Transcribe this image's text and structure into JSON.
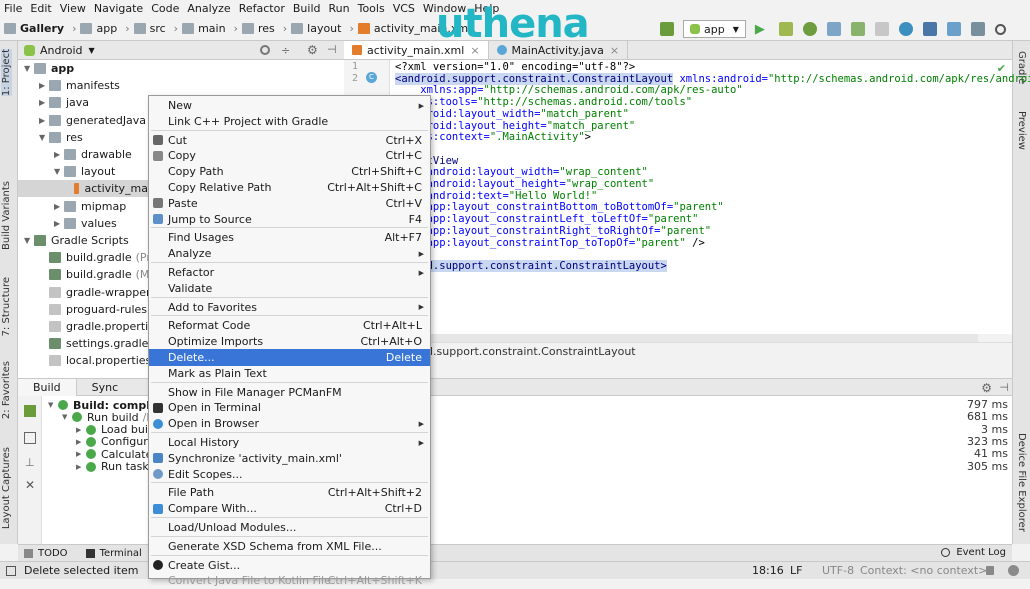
{
  "menubar": [
    "File",
    "Edit",
    "View",
    "Navigate",
    "Code",
    "Analyze",
    "Refactor",
    "Build",
    "Run",
    "Tools",
    "VCS",
    "Window",
    "Help"
  ],
  "breadcrumbs": [
    "Gallery",
    "app",
    "src",
    "main",
    "res",
    "layout",
    "activity_main.xml"
  ],
  "watermark": {
    "text": "uthena",
    "color": "#23b7c6"
  },
  "toolbar": {
    "run_config": "app"
  },
  "left_strip": [
    "1: Project",
    "Build Variants",
    "7: Structure",
    "2: Favorites",
    "Layout Captures"
  ],
  "right_strip": [
    "Gradle",
    "Preview",
    "Device File Explorer"
  ],
  "project": {
    "view": "Android",
    "tree": [
      {
        "label": "app",
        "depth": 0,
        "icon": "folder",
        "expanded": true,
        "bold": true
      },
      {
        "label": "manifests",
        "depth": 1,
        "icon": "folder"
      },
      {
        "label": "java",
        "depth": 1,
        "icon": "folder"
      },
      {
        "label": "generatedJava",
        "depth": 1,
        "icon": "folder"
      },
      {
        "label": "res",
        "depth": 1,
        "icon": "folder",
        "expanded": true
      },
      {
        "label": "drawable",
        "depth": 2,
        "icon": "folder"
      },
      {
        "label": "layout",
        "depth": 2,
        "icon": "folder",
        "expanded": true
      },
      {
        "label": "activity_ma",
        "depth": 3,
        "icon": "xml",
        "selected": true
      },
      {
        "label": "mipmap",
        "depth": 2,
        "icon": "folder"
      },
      {
        "label": "values",
        "depth": 2,
        "icon": "folder"
      },
      {
        "label": "Gradle Scripts",
        "depth": 0,
        "icon": "gradle",
        "expanded": true
      },
      {
        "label": "build.gradle",
        "extra": "(Proj",
        "depth": 1,
        "icon": "gradle"
      },
      {
        "label": "build.gradle",
        "extra": "(Mod",
        "depth": 1,
        "icon": "gradle"
      },
      {
        "label": "gradle-wrapper.p",
        "depth": 1,
        "icon": "file"
      },
      {
        "label": "proguard-rules.pr",
        "depth": 1,
        "icon": "file"
      },
      {
        "label": "gradle.properties",
        "depth": 1,
        "icon": "file"
      },
      {
        "label": "settings.gradle",
        "extra": "(F",
        "depth": 1,
        "icon": "gradle"
      },
      {
        "label": "local.properties",
        "extra": "(S",
        "depth": 1,
        "icon": "file"
      }
    ]
  },
  "editor": {
    "tabs": [
      {
        "label": "activity_main.xml",
        "active": true
      },
      {
        "label": "MainActivity.java",
        "active": false
      }
    ],
    "line_numbers": [
      "1",
      "2"
    ],
    "lines": [
      [
        {
          "t": "<?xml version=\"1.0\" encoding=\"utf-8\"?>",
          "c": ""
        }
      ],
      [
        {
          "t": "<android.support.constraint.ConstraintLayout",
          "c": "tg hl"
        },
        {
          "t": " xmlns:android=",
          "c": "at"
        },
        {
          "t": "\"http://schemas.android.com/apk/res/android\"",
          "c": "vl"
        }
      ],
      [
        {
          "t": "    xmlns:app=",
          "c": "at"
        },
        {
          "t": "\"http://schemas.android.com/apk/res-auto\"",
          "c": "vl"
        }
      ],
      [
        {
          "t": "   lns:tools=",
          "c": "at"
        },
        {
          "t": "\"http://schemas.android.com/tools\"",
          "c": "vl"
        }
      ],
      [
        {
          "t": "   ndroid:layout_width=",
          "c": "at"
        },
        {
          "t": "\"match_parent\"",
          "c": "vl"
        }
      ],
      [
        {
          "t": "   ndroid:layout_height=",
          "c": "at"
        },
        {
          "t": "\"match_parent\"",
          "c": "vl"
        }
      ],
      [
        {
          "t": "   ols:context=",
          "c": "at"
        },
        {
          "t": "\".MainActivity\"",
          "c": "vl"
        },
        {
          "t": ">",
          "c": ""
        }
      ],
      [
        {
          "t": "",
          "c": ""
        }
      ],
      [
        {
          "t": "   extView",
          "c": "tg"
        }
      ],
      [
        {
          "t": "     android:layout_width=",
          "c": "at"
        },
        {
          "t": "\"wrap_content\"",
          "c": "vl"
        }
      ],
      [
        {
          "t": "     android:layout_height=",
          "c": "at"
        },
        {
          "t": "\"wrap_content\"",
          "c": "vl"
        }
      ],
      [
        {
          "t": "     android:text=",
          "c": "at"
        },
        {
          "t": "\"Hello World!\"",
          "c": "vl"
        }
      ],
      [
        {
          "t": "     app:layout_constraintBottom_toBottomOf=",
          "c": "at"
        },
        {
          "t": "\"parent\"",
          "c": "vl"
        }
      ],
      [
        {
          "t": "     app:layout_constraintLeft_toLeftOf=",
          "c": "at"
        },
        {
          "t": "\"parent\"",
          "c": "vl"
        }
      ],
      [
        {
          "t": "     app:layout_constraintRight_toRightOf=",
          "c": "at"
        },
        {
          "t": "\"parent\"",
          "c": "vl"
        }
      ],
      [
        {
          "t": "     app:layout_constraintTop_toTopOf=",
          "c": "at"
        },
        {
          "t": "\"parent\"",
          "c": "vl"
        },
        {
          "t": " />",
          "c": ""
        }
      ],
      [
        {
          "t": "",
          "c": ""
        }
      ],
      [
        {
          "t": "   oid.support.constraint.ConstraintLayout>",
          "c": "tg hl"
        }
      ]
    ],
    "breadcrumb": "l.support.constraint.ConstraintLayout"
  },
  "build": {
    "tabs": [
      "Build",
      "Sync"
    ],
    "tree": [
      {
        "label": "Build: complet",
        "depth": 0,
        "bold": true
      },
      {
        "label": "Run build",
        "extra": "/h",
        "depth": 1
      },
      {
        "label": "Load buil",
        "depth": 2
      },
      {
        "label": "Configure",
        "depth": 2
      },
      {
        "label": "Calculate",
        "depth": 2
      },
      {
        "label": "Run tasks",
        "depth": 2
      }
    ],
    "times": [
      "797 ms",
      "681 ms",
      "3 ms",
      "323 ms",
      "41 ms",
      "305 ms"
    ]
  },
  "bottom_tabs": {
    "todo": "TODO",
    "terminal": "Terminal",
    "event_log": "Event Log"
  },
  "status": {
    "message": "Delete selected item",
    "position": "18:16",
    "line_sep": "LF",
    "encoding": "UTF-8",
    "context": "Context: <no context>"
  },
  "context_menu": [
    {
      "label": "New",
      "submenu": true
    },
    {
      "label": "Link C++ Project with Gradle"
    },
    {
      "sep": true
    },
    {
      "label": "Cut",
      "shortcut": "Ctrl+X",
      "icon": "cut-icon"
    },
    {
      "label": "Copy",
      "shortcut": "Ctrl+C",
      "icon": "copy-icon"
    },
    {
      "label": "Copy Path",
      "shortcut": "Ctrl+Shift+C"
    },
    {
      "label": "Copy Relative Path",
      "shortcut": "Ctrl+Alt+Shift+C"
    },
    {
      "label": "Paste",
      "shortcut": "Ctrl+V",
      "icon": "paste-icon"
    },
    {
      "label": "Jump to Source",
      "shortcut": "F4",
      "icon": "jump-icon"
    },
    {
      "sep": true
    },
    {
      "label": "Find Usages",
      "shortcut": "Alt+F7"
    },
    {
      "label": "Analyze",
      "submenu": true
    },
    {
      "sep": true
    },
    {
      "label": "Refactor",
      "submenu": true
    },
    {
      "label": "Validate"
    },
    {
      "sep": true
    },
    {
      "label": "Add to Favorites",
      "submenu": true
    },
    {
      "sep": true
    },
    {
      "label": "Reformat Code",
      "shortcut": "Ctrl+Alt+L"
    },
    {
      "label": "Optimize Imports",
      "shortcut": "Ctrl+Alt+O"
    },
    {
      "label": "Delete...",
      "shortcut": "Delete",
      "selected": true
    },
    {
      "label": "Mark as Plain Text"
    },
    {
      "sep": true
    },
    {
      "label": "Show in File Manager PCManFM"
    },
    {
      "label": "Open in Terminal",
      "icon": "terminal-icon"
    },
    {
      "label": "Open in Browser",
      "submenu": true,
      "icon": "browser-icon"
    },
    {
      "sep": true
    },
    {
      "label": "Local History",
      "submenu": true
    },
    {
      "label": "Synchronize 'activity_main.xml'",
      "icon": "sync-icon"
    },
    {
      "label": "Edit Scopes...",
      "icon": "scopes-icon"
    },
    {
      "sep": true
    },
    {
      "label": "File Path",
      "shortcut": "Ctrl+Alt+Shift+2"
    },
    {
      "label": "Compare With...",
      "shortcut": "Ctrl+D",
      "icon": "compare-icon"
    },
    {
      "sep": true
    },
    {
      "label": "Load/Unload Modules..."
    },
    {
      "sep": true
    },
    {
      "label": "Generate XSD Schema from XML File..."
    },
    {
      "sep": true
    },
    {
      "label": "Create Gist...",
      "icon": "github-icon"
    },
    {
      "label": "Convert Java File to Kotlin File",
      "shortcut": "Ctrl+Alt+Shift+K",
      "disabled": true
    }
  ]
}
